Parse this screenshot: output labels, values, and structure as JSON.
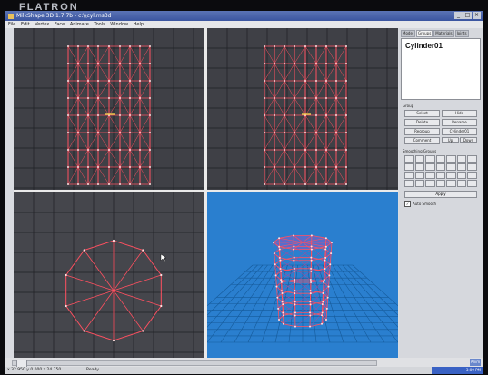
{
  "monitor": {
    "brand": "FLATRON"
  },
  "app": {
    "title": "MilkShape 3D 1.7.7b - c:\\\\cyl.ms3d",
    "window_buttons": [
      "_",
      "□",
      "×"
    ]
  },
  "menu": [
    "File",
    "Edit",
    "Vertex",
    "Face",
    "Animate",
    "Tools",
    "Window",
    "Help"
  ],
  "panel": {
    "tabs": [
      "Model",
      "Groups",
      "Materials",
      "Joints"
    ],
    "active_tab": "Groups",
    "selected_object": "Cylinder01",
    "group_section_label": "Group",
    "group_buttons": [
      "Select",
      "Hide",
      "Delete",
      "Rename",
      "Regroup",
      "Cylinder01",
      "Comment",
      "Up",
      "Down"
    ],
    "smoothing_label": "Smoothing Groups",
    "apply_label": "Apply",
    "auto_smooth_label": "Auto Smooth",
    "auto_smooth_checked": "✓"
  },
  "status": {
    "coords": "x 32.950 y 0.000 z 24.750",
    "state": "Ready"
  },
  "bottom": {
    "anim_label": "Anim"
  },
  "taskbar": {
    "clock": "3:09 PM"
  },
  "colors": {
    "viewport_bg_dark": "#3f4046",
    "viewport_bg_3d": "#2a7fcf",
    "wire": "#ff5060",
    "vertex": "#ffe0e0"
  },
  "viewports": [
    {
      "name": "front",
      "view": "cylinder-side-wireframe"
    },
    {
      "name": "left",
      "view": "cylinder-side-wireframe"
    },
    {
      "name": "top",
      "view": "cylinder-top-decagon"
    },
    {
      "name": "3d",
      "view": "cylinder-perspective-on-grid"
    }
  ]
}
